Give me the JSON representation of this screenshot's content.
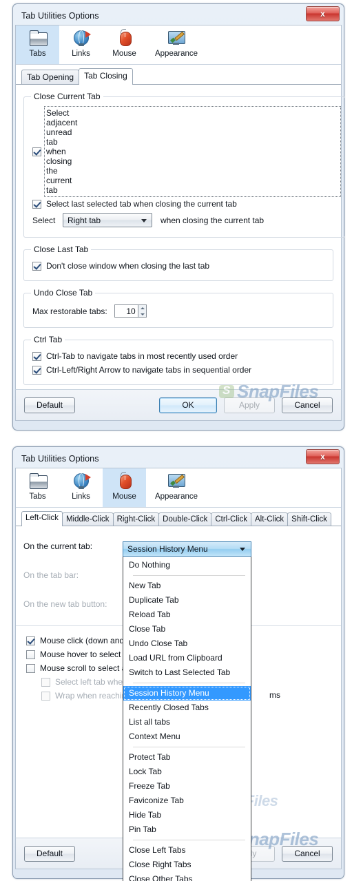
{
  "dialog_one": {
    "title": "Tab Utilities Options",
    "close_label": "x",
    "toolbar": [
      {
        "label": "Tabs",
        "icon": "folder-icon",
        "selected": true
      },
      {
        "label": "Links",
        "icon": "globe-icon",
        "selected": false
      },
      {
        "label": "Mouse",
        "icon": "mouse-icon",
        "selected": false
      },
      {
        "label": "Appearance",
        "icon": "monitor-brush-icon",
        "selected": false
      }
    ],
    "tabs": [
      {
        "label": "Tab Opening",
        "active": false
      },
      {
        "label": "Tab Closing",
        "active": true
      }
    ],
    "groups": {
      "close_current_tab": {
        "legend": "Close Current Tab",
        "check_adjacent": "Select adjacent unread tab when closing the current tab",
        "check_last_selected": "Select last selected tab when closing the current tab",
        "select_prefix": "Select",
        "select_value": "Right tab",
        "select_suffix": "when closing the current tab"
      },
      "close_last_tab": {
        "legend": "Close Last Tab",
        "check_dont_close": "Don't close window when closing the last tab"
      },
      "undo_close_tab": {
        "legend": "Undo Close Tab",
        "max_label": "Max restorable tabs:",
        "max_value": "10"
      },
      "ctrl_tab": {
        "legend": "Ctrl Tab",
        "check_ctrl_tab": "Ctrl-Tab to navigate tabs in most recently used order",
        "check_ctrl_arrow": "Ctrl-Left/Right Arrow to navigate tabs in sequential order"
      }
    },
    "buttons": {
      "default": "Default",
      "ok": "OK",
      "apply": "Apply",
      "cancel": "Cancel"
    },
    "watermark": "SnapFiles"
  },
  "dialog_two": {
    "title": "Tab Utilities Options",
    "close_label": "x",
    "toolbar": [
      {
        "label": "Tabs",
        "icon": "folder-icon",
        "selected": false
      },
      {
        "label": "Links",
        "icon": "globe-icon",
        "selected": false
      },
      {
        "label": "Mouse",
        "icon": "mouse-icon",
        "selected": true
      },
      {
        "label": "Appearance",
        "icon": "monitor-brush-icon",
        "selected": false
      }
    ],
    "tabs": [
      {
        "label": "Left-Click",
        "active": true
      },
      {
        "label": "Middle-Click",
        "active": false
      },
      {
        "label": "Right-Click",
        "active": false
      },
      {
        "label": "Double-Click",
        "active": false
      },
      {
        "label": "Ctrl-Click",
        "active": false
      },
      {
        "label": "Alt-Click",
        "active": false
      },
      {
        "label": "Shift-Click",
        "active": false
      }
    ],
    "captions": {
      "current_tab": "On the current tab:",
      "tab_bar": "On the tab bar:",
      "new_tab_button": "On the new tab button:"
    },
    "checks": {
      "mouse_click": "Mouse click (down and",
      "mouse_hover": "Mouse hover to select a",
      "mouse_scroll": "Mouse scroll to select a",
      "select_left": "Select left tab when",
      "wrap_reaching": "Wrap when reaching",
      "clipped_suffix": "ms"
    },
    "dropdown": {
      "selected_value": "Session History Menu",
      "options": [
        {
          "label": "Do Nothing",
          "sep_after": true
        },
        {
          "label": "New Tab"
        },
        {
          "label": "Duplicate Tab"
        },
        {
          "label": "Reload Tab"
        },
        {
          "label": "Close Tab"
        },
        {
          "label": "Undo Close Tab"
        },
        {
          "label": "Load URL from Clipboard"
        },
        {
          "label": "Switch to Last Selected Tab",
          "sep_after": true
        },
        {
          "label": "Session History Menu",
          "selected": true
        },
        {
          "label": "Recently Closed Tabs"
        },
        {
          "label": "List all tabs"
        },
        {
          "label": "Context Menu",
          "sep_after": true
        },
        {
          "label": "Protect Tab"
        },
        {
          "label": "Lock Tab"
        },
        {
          "label": "Freeze Tab"
        },
        {
          "label": "Faviconize Tab"
        },
        {
          "label": "Hide Tab"
        },
        {
          "label": "Pin Tab",
          "sep_after": true
        },
        {
          "label": "Close Left Tabs"
        },
        {
          "label": "Close Right Tabs"
        },
        {
          "label": "Close Other Tabs"
        }
      ]
    },
    "buttons": {
      "default": "Default",
      "apply": "ly",
      "cancel": "Cancel"
    },
    "watermark": "SnapFiles"
  }
}
